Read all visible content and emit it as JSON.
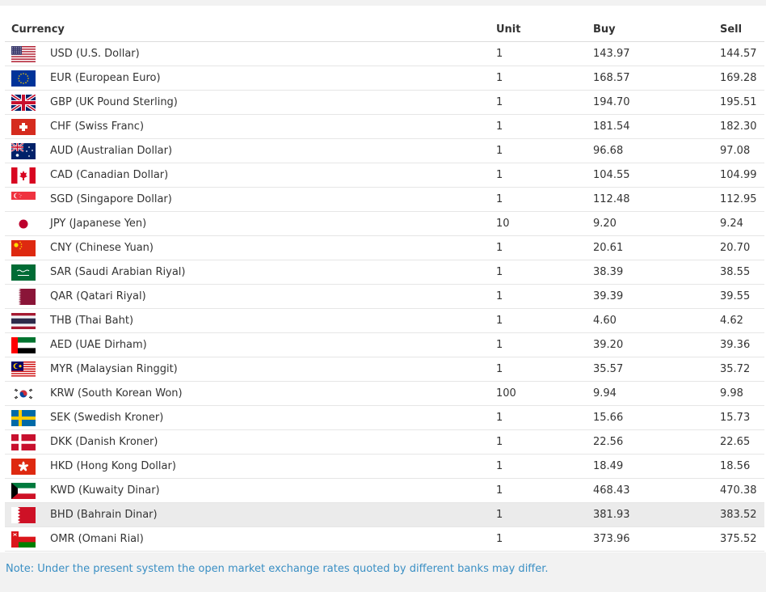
{
  "headers": {
    "currency": "Currency",
    "unit": "Unit",
    "buy": "Buy",
    "sell": "Sell"
  },
  "rows": [
    {
      "flag": "us-flag-icon",
      "currency": "USD (U.S. Dollar)",
      "unit": "1",
      "buy": "143.97",
      "sell": "144.57"
    },
    {
      "flag": "eu-flag-icon",
      "currency": "EUR (European Euro)",
      "unit": "1",
      "buy": "168.57",
      "sell": "169.28"
    },
    {
      "flag": "uk-flag-icon",
      "currency": "GBP (UK Pound Sterling)",
      "unit": "1",
      "buy": "194.70",
      "sell": "195.51"
    },
    {
      "flag": "ch-flag-icon",
      "currency": "CHF (Swiss Franc)",
      "unit": "1",
      "buy": "181.54",
      "sell": "182.30"
    },
    {
      "flag": "au-flag-icon",
      "currency": "AUD (Australian Dollar)",
      "unit": "1",
      "buy": "96.68",
      "sell": "97.08"
    },
    {
      "flag": "ca-flag-icon",
      "currency": "CAD (Canadian Dollar)",
      "unit": "1",
      "buy": "104.55",
      "sell": "104.99"
    },
    {
      "flag": "sg-flag-icon",
      "currency": "SGD (Singapore Dollar)",
      "unit": "1",
      "buy": "112.48",
      "sell": "112.95"
    },
    {
      "flag": "jp-flag-icon",
      "currency": "JPY (Japanese Yen)",
      "unit": "10",
      "buy": "9.20",
      "sell": "9.24"
    },
    {
      "flag": "cn-flag-icon",
      "currency": "CNY (Chinese Yuan)",
      "unit": "1",
      "buy": "20.61",
      "sell": "20.70"
    },
    {
      "flag": "sa-flag-icon",
      "currency": "SAR (Saudi Arabian Riyal)",
      "unit": "1",
      "buy": "38.39",
      "sell": "38.55"
    },
    {
      "flag": "qa-flag-icon",
      "currency": "QAR (Qatari Riyal)",
      "unit": "1",
      "buy": "39.39",
      "sell": "39.55"
    },
    {
      "flag": "th-flag-icon",
      "currency": "THB (Thai Baht)",
      "unit": "1",
      "buy": "4.60",
      "sell": "4.62"
    },
    {
      "flag": "ae-flag-icon",
      "currency": "AED (UAE Dirham)",
      "unit": "1",
      "buy": "39.20",
      "sell": "39.36"
    },
    {
      "flag": "my-flag-icon",
      "currency": "MYR (Malaysian Ringgit)",
      "unit": "1",
      "buy": "35.57",
      "sell": "35.72"
    },
    {
      "flag": "kr-flag-icon",
      "currency": "KRW (South Korean Won)",
      "unit": "100",
      "buy": "9.94",
      "sell": "9.98"
    },
    {
      "flag": "se-flag-icon",
      "currency": "SEK (Swedish Kroner)",
      "unit": "1",
      "buy": "15.66",
      "sell": "15.73"
    },
    {
      "flag": "dk-flag-icon",
      "currency": "DKK (Danish Kroner)",
      "unit": "1",
      "buy": "22.56",
      "sell": "22.65"
    },
    {
      "flag": "hk-flag-icon",
      "currency": "HKD (Hong Kong Dollar)",
      "unit": "1",
      "buy": "18.49",
      "sell": "18.56"
    },
    {
      "flag": "kw-flag-icon",
      "currency": "KWD (Kuwaity Dinar)",
      "unit": "1",
      "buy": "468.43",
      "sell": "470.38"
    },
    {
      "flag": "bh-flag-icon",
      "currency": "BHD (Bahrain Dinar)",
      "unit": "1",
      "buy": "381.93",
      "sell": "383.52",
      "highlighted": true
    },
    {
      "flag": "om-flag-icon",
      "currency": "OMR (Omani Rial)",
      "unit": "1",
      "buy": "373.96",
      "sell": "375.52"
    }
  ],
  "note": "Note: Under the present system the open market exchange rates quoted by different banks may differ.",
  "colors": {
    "note": "#3a8fc4",
    "highlight_row": "#ebebeb",
    "background": "#f2f2f2"
  }
}
